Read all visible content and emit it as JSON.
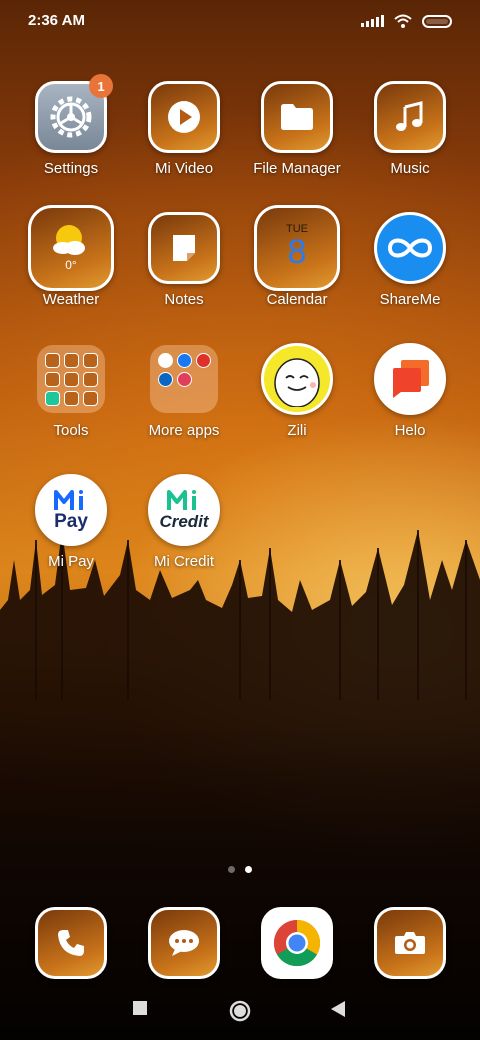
{
  "status_bar": {
    "time": "2:36 AM"
  },
  "apps": [
    {
      "id": "settings",
      "label": "Settings",
      "badge": "1"
    },
    {
      "id": "mi-video",
      "label": "Mi Video"
    },
    {
      "id": "file-manager",
      "label": "File Manager"
    },
    {
      "id": "music",
      "label": "Music"
    },
    {
      "id": "weather",
      "label": "Weather",
      "temp": "0°"
    },
    {
      "id": "notes",
      "label": "Notes"
    },
    {
      "id": "calendar",
      "label": "Calendar",
      "day": "TUE",
      "date": "8"
    },
    {
      "id": "shareme",
      "label": "ShareMe"
    },
    {
      "id": "tools",
      "label": "Tools"
    },
    {
      "id": "more-apps",
      "label": "More apps"
    },
    {
      "id": "zili",
      "label": "Zili"
    },
    {
      "id": "helo",
      "label": "Helo"
    },
    {
      "id": "mi-pay",
      "label": "Mi Pay",
      "logo_text": "Pay"
    },
    {
      "id": "mi-credit",
      "label": "Mi Credit",
      "logo_text": "Credit"
    }
  ],
  "dock": [
    {
      "id": "phone",
      "icon": "phone-icon"
    },
    {
      "id": "messages",
      "icon": "message-icon"
    },
    {
      "id": "chrome",
      "icon": "chrome-icon"
    },
    {
      "id": "camera",
      "icon": "camera-icon"
    }
  ],
  "page_indicator": {
    "total": 2,
    "current": 2
  },
  "colors": {
    "badge": "#e8743a",
    "shareme": "#1a8ef0",
    "zili": "#f5e72a",
    "mi_blue": "#1769ff",
    "mi_green": "#19c28e"
  }
}
